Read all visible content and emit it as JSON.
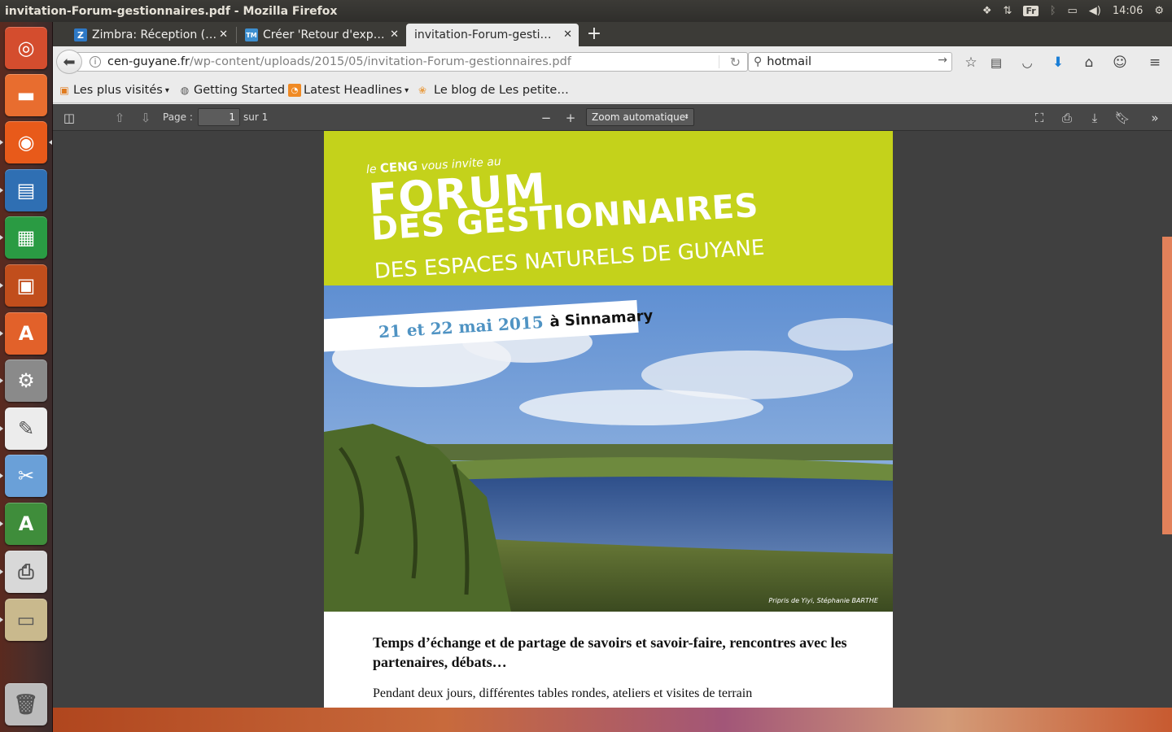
{
  "system_panel": {
    "window_title": "invitation-Forum-gestionnaires.pdf - Mozilla Firefox",
    "keyboard_layout": "Fr",
    "clock": "14:06"
  },
  "launcher": {
    "items": [
      {
        "name": "ubuntu-dash",
        "color": "#d44d2e"
      },
      {
        "name": "files",
        "color": "#e86d2f"
      },
      {
        "name": "firefox",
        "color": "#e85a1a"
      },
      {
        "name": "libreoffice-writer",
        "color": "#2f6fb3"
      },
      {
        "name": "libreoffice-calc",
        "color": "#2a9b43"
      },
      {
        "name": "libreoffice-impress",
        "color": "#c14e1c"
      },
      {
        "name": "software-center",
        "color": "#e2612a"
      },
      {
        "name": "system-settings",
        "color": "#8a8a8a"
      },
      {
        "name": "text-editor",
        "color": "#ececec"
      },
      {
        "name": "screenshot",
        "color": "#6aa0d8"
      },
      {
        "name": "software-updater",
        "color": "#3f8d3b"
      },
      {
        "name": "printer",
        "color": "#d8d8d8"
      },
      {
        "name": "archive-manager",
        "color": "#c9b98d"
      },
      {
        "name": "trash",
        "color": "#bcbcbc"
      }
    ]
  },
  "tabs": [
    {
      "label": "Zimbra: Réception (…",
      "favicon": "Z",
      "favicon_color": "#2e79c6"
    },
    {
      "label": "Créer 'Retour d'exp…",
      "favicon": "TM",
      "favicon_color": "#3d8fd0"
    },
    {
      "label": "invitation-Forum-gesti…",
      "favicon": "",
      "favicon_color": ""
    }
  ],
  "navbar": {
    "url_host": "cen-guyane.fr",
    "url_path": "/wp-content/uploads/2015/05/invitation-Forum-gestionnaires.pdf",
    "search_value": "hotmail"
  },
  "bookmarks": [
    {
      "label": "Les plus visités",
      "icon": "folder-star-icon",
      "dropdown": true
    },
    {
      "label": "Getting Started",
      "icon": "globe-icon",
      "dropdown": false
    },
    {
      "label": "Latest Headlines",
      "icon": "rss-icon",
      "dropdown": true
    },
    {
      "label": "Le blog de Les petite…",
      "icon": "blog-icon",
      "dropdown": false
    }
  ],
  "pdf_toolbar": {
    "page_label": "Page :",
    "page_value": "1",
    "page_total": "sur 1",
    "zoom": "Zoom automatique"
  },
  "pdf_content": {
    "intro_prefix": "le",
    "intro_org": "CENG",
    "intro_suffix": "vous invite au",
    "heading_1": "FORUM",
    "heading_2": "DES GESTIONNAIRES",
    "heading_3": "DES ESPACES NATURELS DE GUYANE",
    "date": "21 et 22 mai 2015",
    "place": "à Sinnamary",
    "photo_credit": "Pripris de Yiyi, Stéphanie BARTHE",
    "lead": "Temps d’échange et de partage de savoirs et savoir-faire, rencontres avec les partenaires, débats…",
    "body": "Pendant deux jours, différentes tables rondes, ateliers et visites de terrain"
  },
  "colors": {
    "brochure_green": "#c4d21b",
    "date_blue": "#4f93c3",
    "pdf_background": "#404040",
    "pdf_toolbar": "#474747"
  }
}
